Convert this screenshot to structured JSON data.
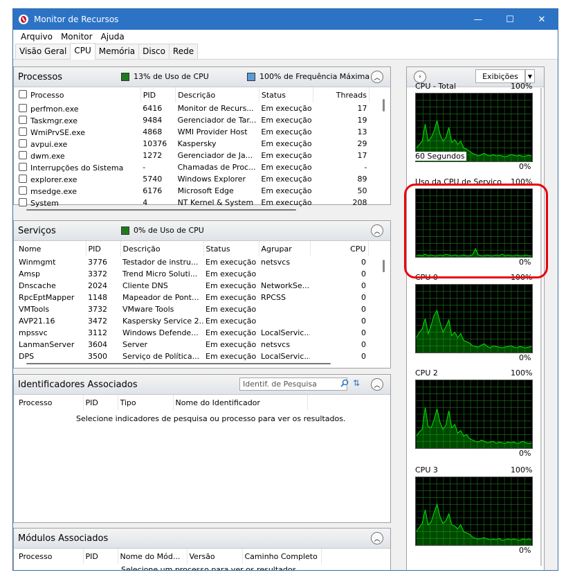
{
  "window": {
    "title": "Monitor de Recursos",
    "controls": {
      "minimize": "—",
      "maximize": "☐",
      "close": "✕"
    }
  },
  "menu": [
    "Arquivo",
    "Monitor",
    "Ajuda"
  ],
  "tabs": [
    "Visão Geral",
    "CPU",
    "Memória",
    "Disco",
    "Rede"
  ],
  "active_tab": "CPU",
  "processos": {
    "title": "Processos",
    "indicator1": "13% de Uso de CPU",
    "indicator2": "100% de Frequência Máxima",
    "indicator1_color": "#1f7a1f",
    "indicator2_color": "#5b9bd5",
    "columns": [
      "Processo",
      "PID",
      "Descrição",
      "Status",
      "Threads"
    ],
    "rows": [
      {
        "name": "perfmon.exe",
        "pid": "6416",
        "desc": "Monitor de Recurs...",
        "status": "Em execução",
        "threads": "17"
      },
      {
        "name": "Taskmgr.exe",
        "pid": "9484",
        "desc": "Gerenciador de Tar...",
        "status": "Em execução",
        "threads": "19"
      },
      {
        "name": "WmiPrvSE.exe",
        "pid": "4868",
        "desc": "WMI Provider Host",
        "status": "Em execução",
        "threads": "13"
      },
      {
        "name": "avpui.exe",
        "pid": "10376",
        "desc": "Kaspersky",
        "status": "Em execução",
        "threads": "29"
      },
      {
        "name": "dwm.exe",
        "pid": "1272",
        "desc": "Gerenciador de Ja...",
        "status": "Em execução",
        "threads": "17"
      },
      {
        "name": "Interrupções do Sistema",
        "pid": "-",
        "desc": "Chamadas de Proc...",
        "status": "Em execução",
        "threads": "-"
      },
      {
        "name": "explorer.exe",
        "pid": "5740",
        "desc": "Windows Explorer",
        "status": "Em execução",
        "threads": "89"
      },
      {
        "name": "msedge.exe",
        "pid": "6176",
        "desc": "Microsoft Edge",
        "status": "Em execução",
        "threads": "50"
      },
      {
        "name": "System",
        "pid": "4",
        "desc": "NT Kernel & System",
        "status": "Em execução",
        "threads": "208"
      }
    ]
  },
  "servicos": {
    "title": "Serviços",
    "indicator": "0% de Uso de CPU",
    "indicator_color": "#1f7a1f",
    "columns": [
      "Nome",
      "PID",
      "Descrição",
      "Status",
      "Agrupar",
      "CPU"
    ],
    "rows": [
      {
        "name": "Winmgmt",
        "pid": "3776",
        "desc": "Testador de instru...",
        "status": "Em execução",
        "group": "netsvcs",
        "cpu": "0"
      },
      {
        "name": "Amsp",
        "pid": "3372",
        "desc": "Trend Micro Soluti...",
        "status": "Em execução",
        "group": "",
        "cpu": "0"
      },
      {
        "name": "Dnscache",
        "pid": "2024",
        "desc": "Cliente DNS",
        "status": "Em execução",
        "group": "NetworkSe...",
        "cpu": "0"
      },
      {
        "name": "RpcEptMapper",
        "pid": "1148",
        "desc": "Mapeador de Pont...",
        "status": "Em execução",
        "group": "RPCSS",
        "cpu": "0"
      },
      {
        "name": "VMTools",
        "pid": "3732",
        "desc": "VMware Tools",
        "status": "Em execução",
        "group": "",
        "cpu": "0"
      },
      {
        "name": "AVP21.16",
        "pid": "3472",
        "desc": "Kaspersky Service 2...",
        "status": "Em execução",
        "group": "",
        "cpu": "0"
      },
      {
        "name": "mpssvc",
        "pid": "3112",
        "desc": "Windows Defende...",
        "status": "Em execução",
        "group": "LocalServic...",
        "cpu": "0"
      },
      {
        "name": "LanmanServer",
        "pid": "3604",
        "desc": "Server",
        "status": "Em execução",
        "group": "netsvcs",
        "cpu": "0"
      },
      {
        "name": "DPS",
        "pid": "3500",
        "desc": "Serviço de Política...",
        "status": "Em execução",
        "group": "LocalServic...",
        "cpu": "0"
      }
    ]
  },
  "identificadores": {
    "title": "Identificadores Associados",
    "search_placeholder": "Identif. de Pesquisa",
    "columns": [
      "Processo",
      "PID",
      "Tipo",
      "Nome do Identificador"
    ],
    "message": "Selecione indicadores de pesquisa ou processo para ver os resultados."
  },
  "modulos": {
    "title": "Módulos Associados",
    "columns": [
      "Processo",
      "PID",
      "Nome do Mód...",
      "Versão",
      "Caminho Completo"
    ],
    "message": "Selecione um processo para ver os resultados."
  },
  "right_panel": {
    "views_label": "Exibições",
    "graphs": [
      {
        "label": "CPU - Total",
        "max": "100%",
        "min": "0%",
        "footer": "60 Segundos",
        "trace": [
          20,
          25,
          30,
          55,
          30,
          35,
          45,
          60,
          40,
          30,
          35,
          50,
          28,
          32,
          25,
          30,
          20,
          18,
          15,
          12,
          10,
          8,
          10,
          12,
          9,
          8,
          10,
          8,
          9,
          8,
          7,
          8,
          10,
          9,
          8,
          9,
          7,
          8,
          9,
          8
        ]
      },
      {
        "label": "Uso da CPU de Serviço",
        "max": "100%",
        "min": "0%",
        "footer": "",
        "trace": [
          2,
          3,
          2,
          4,
          2,
          3,
          2,
          2,
          3,
          2,
          4,
          3,
          2,
          3,
          2,
          2,
          3,
          2,
          2,
          3,
          12,
          3,
          2,
          2,
          3,
          2,
          2,
          3,
          2,
          4,
          2,
          3,
          2,
          2,
          3,
          2,
          2,
          3,
          2,
          2
        ]
      },
      {
        "label": "CPU 0",
        "max": "100%",
        "min": "0%",
        "footer": "",
        "trace": [
          22,
          30,
          35,
          50,
          28,
          40,
          55,
          62,
          45,
          30,
          38,
          48,
          25,
          30,
          22,
          28,
          18,
          16,
          14,
          10,
          9,
          8,
          11,
          13,
          9,
          7,
          10,
          9,
          8,
          7,
          8,
          9,
          10,
          8,
          7,
          9,
          8,
          7,
          8,
          9
        ]
      },
      {
        "label": "CPU 2",
        "max": "100%",
        "min": "0%",
        "footer": "",
        "trace": [
          18,
          24,
          28,
          60,
          32,
          30,
          42,
          58,
          38,
          28,
          34,
          55,
          30,
          35,
          22,
          26,
          18,
          20,
          14,
          12,
          10,
          9,
          12,
          10,
          8,
          9,
          10,
          7,
          9,
          8,
          7,
          9,
          8,
          9,
          7,
          8,
          10,
          8,
          7,
          8
        ]
      },
      {
        "label": "CPU 3",
        "max": "100%",
        "min": "0%",
        "footer": "",
        "trace": [
          20,
          26,
          32,
          52,
          30,
          34,
          48,
          60,
          42,
          32,
          36,
          46,
          30,
          28,
          24,
          30,
          20,
          18,
          16,
          12,
          10,
          9,
          10,
          11,
          9,
          8,
          9,
          8,
          10,
          7,
          8,
          9,
          8,
          9,
          8,
          7,
          9,
          8,
          9,
          8
        ]
      }
    ]
  },
  "colors": {
    "titlebar": "#2c73c6",
    "graph_bg": "#000000",
    "graph_grid": "#1f7a1f",
    "graph_line": "#00d000",
    "highlight": "#e8000b"
  }
}
